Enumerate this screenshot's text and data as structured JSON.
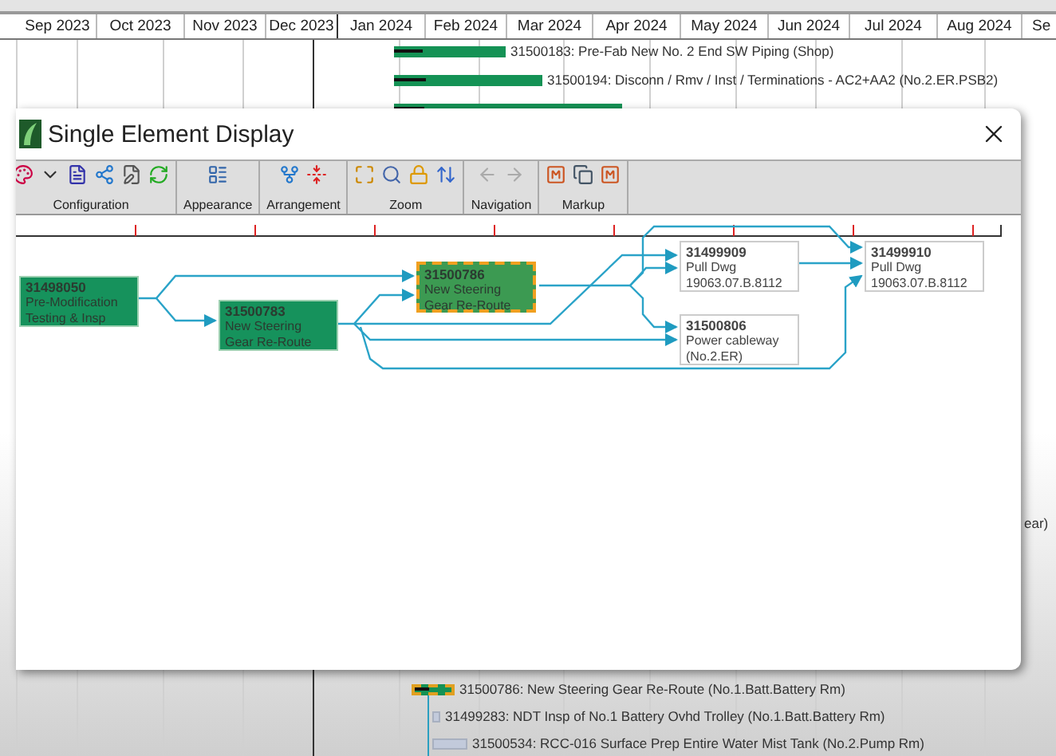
{
  "gantt": {
    "months": [
      "Sep 2023",
      "Oct 2023",
      "Nov 2023",
      "Dec 2023",
      "Jan 2024",
      "Feb 2024",
      "Mar 2024",
      "Apr 2024",
      "May 2024",
      "Jun 2024",
      "Jul 2024",
      "Aug 2024",
      "Se"
    ],
    "tasks": [
      {
        "kind": "progress",
        "label": "31500183: Pre-Fab New No. 2 End SW Piping (Shop)",
        "level": 0.26,
        "selected": false
      },
      {
        "kind": "progress",
        "label": "31500194: Disconn / Rmv / Inst / Terminations - AC2+AA2 (No.2.ER.PSB2)",
        "level": 0.22,
        "selected": false
      },
      {
        "kind": "progress",
        "level": 0.13,
        "selected": false
      },
      {
        "kind": "fragment",
        "label": "ear)"
      },
      {
        "kind": "progress",
        "label": "31500786: New Steering Gear Re-Route (No.1.Batt.Battery Rm)",
        "level": 0.4,
        "selected": true
      },
      {
        "kind": "planned",
        "label": "31499283: NDT Insp of No.1 Battery Ovhd Trolley (No.1.Batt.Battery Rm)",
        "selected": false
      },
      {
        "kind": "planned",
        "label": "31500534: RCC-016 Surface Prep Entire Water Mist Tank (No.2.Pump Rm)",
        "selected": false
      }
    ]
  },
  "dialog": {
    "title": "Single Element Display",
    "toolbar": [
      {
        "label": "Configuration",
        "disabled": false
      },
      {
        "label": "Appearance",
        "disabled": false
      },
      {
        "label": "Arrangement",
        "disabled": false
      },
      {
        "label": "Zoom",
        "disabled": false
      },
      {
        "label": "Navigation",
        "disabled": true
      },
      {
        "label": "Markup",
        "disabled": false
      }
    ],
    "nodes": [
      {
        "kind": "scheduled",
        "code": "31498050",
        "lines": [
          "Pre-Modification",
          "Testing & Insp"
        ],
        "selected": false
      },
      {
        "kind": "scheduled",
        "code": "31500783",
        "lines": [
          "New Steering",
          "Gear Re-Route"
        ],
        "selected": false
      },
      {
        "kind": "scheduled",
        "code": "31500786",
        "lines": [
          "New Steering",
          "Gear Re-Route"
        ],
        "selected": true
      },
      {
        "kind": "linked",
        "code": "31499909",
        "lines": [
          "Pull Dwg",
          "19063.07.B.8112"
        ],
        "selected": false
      },
      {
        "kind": "linked",
        "code": "31500806",
        "lines": [
          "Power cableway",
          "(No.2.ER)"
        ],
        "selected": false
      },
      {
        "kind": "linked",
        "code": "31499910",
        "lines": [
          "Pull Dwg",
          "19063.07.B.8112"
        ],
        "selected": false
      }
    ]
  }
}
